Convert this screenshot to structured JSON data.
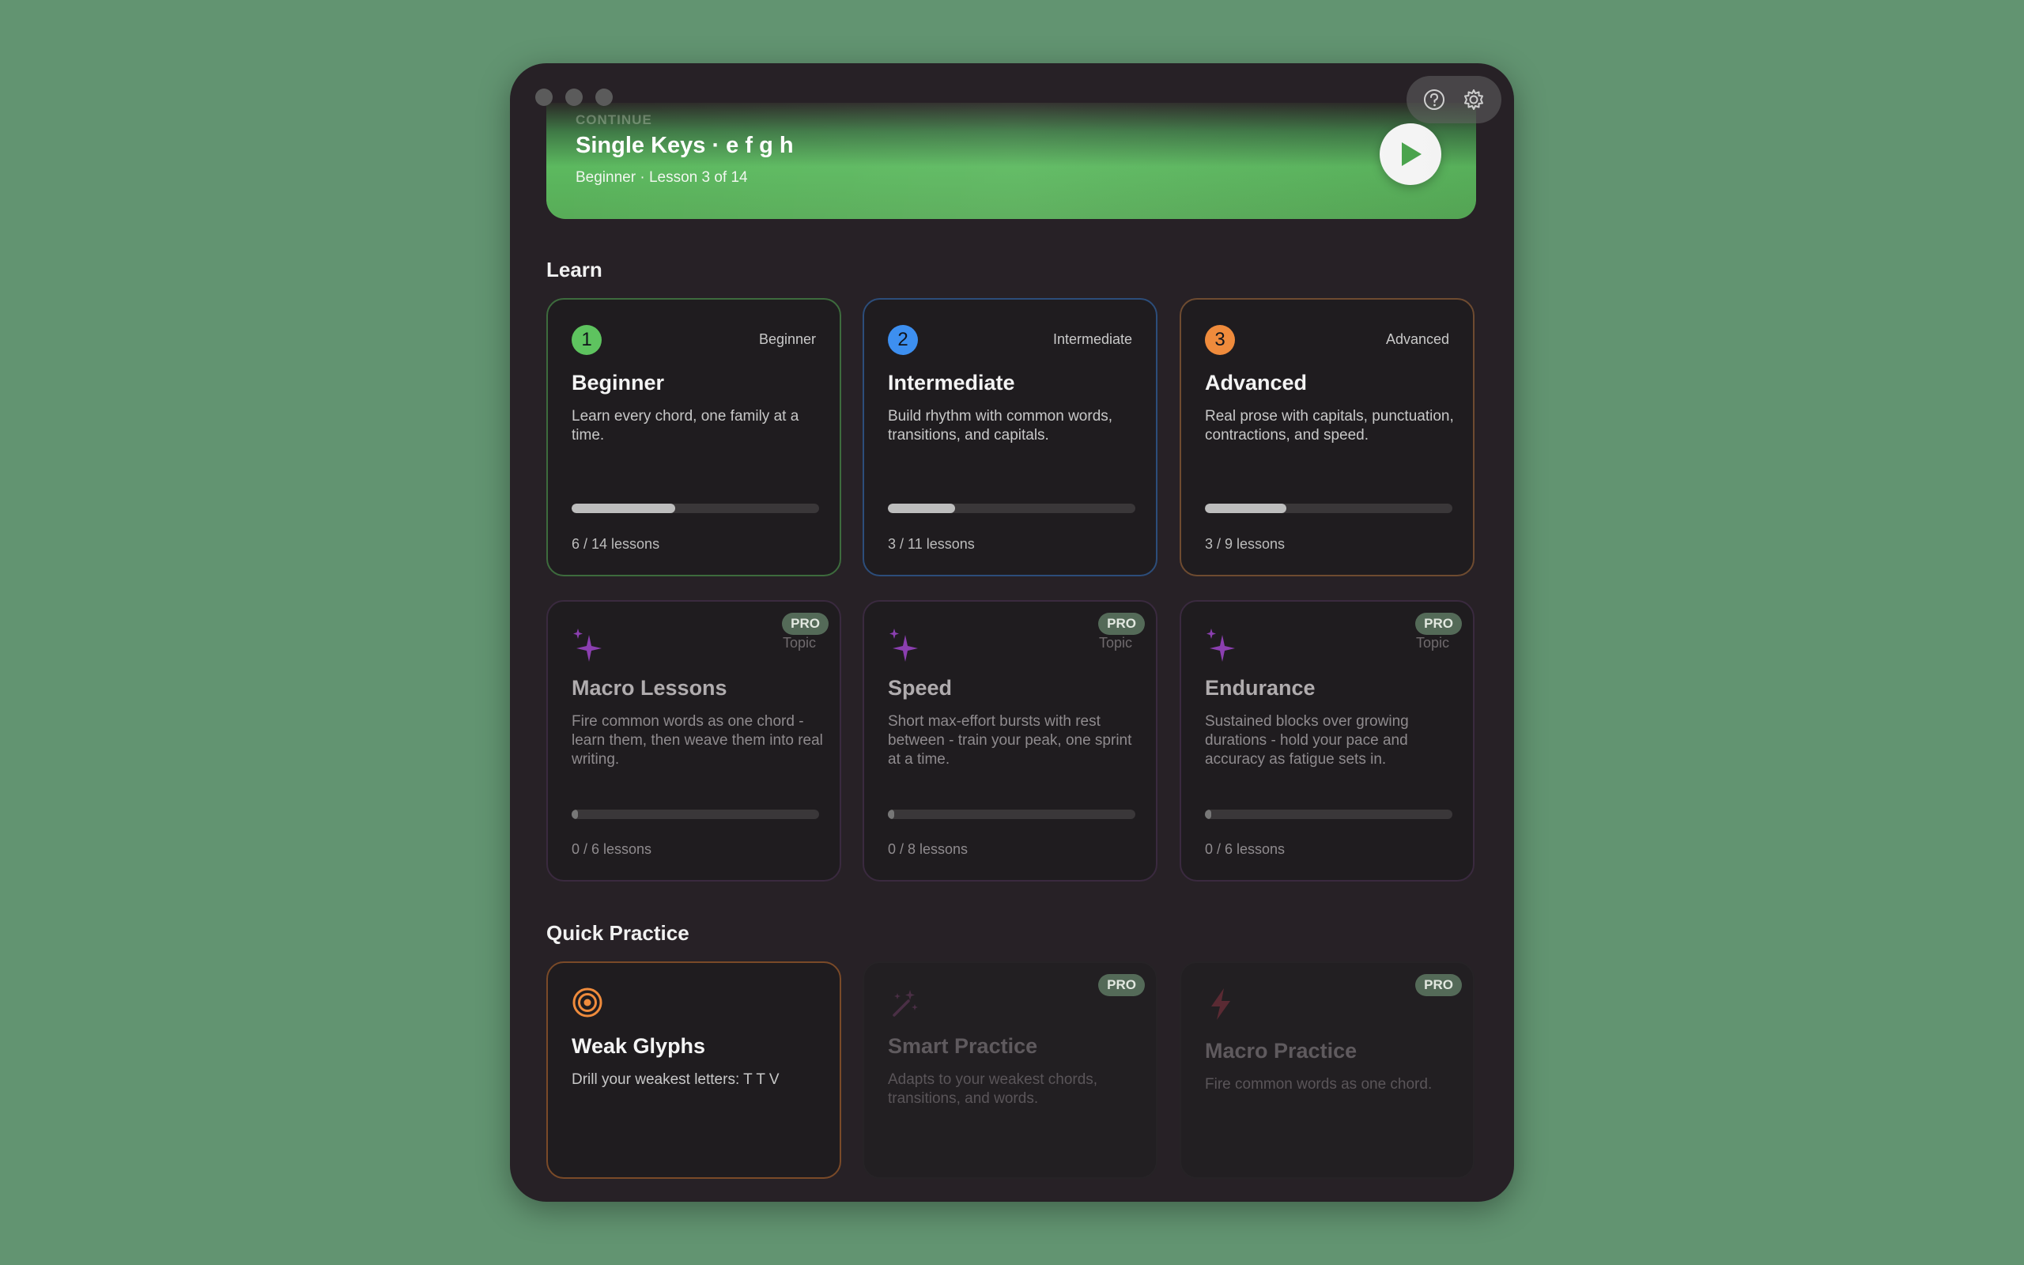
{
  "window": {
    "toolbar": {
      "help_icon": "question-circle-icon",
      "settings_icon": "gear-icon"
    }
  },
  "hero": {
    "kicker": "CONTINUE",
    "title": "Single Keys · e f g h",
    "subtitle": "Beginner · Lesson 3 of 14",
    "play_icon": "play-icon",
    "gradient_color": "#5cb95f"
  },
  "learn": {
    "heading": "Learn",
    "levels": [
      {
        "num": "1",
        "tag": "Beginner",
        "title": "Beginner",
        "desc": "Learn every chord, one family at a time.",
        "progress": 0.42,
        "count": "6 / 14 lessons",
        "color": "#5ec35f"
      },
      {
        "num": "2",
        "tag": "Intermediate",
        "title": "Intermediate",
        "desc": "Build rhythm with common words, transitions, and capitals.",
        "progress": 0.27,
        "count": "3 / 11 lessons",
        "color": "#3d8ff0"
      },
      {
        "num": "3",
        "tag": "Advanced",
        "title": "Advanced",
        "desc": "Real prose with capitals, punctuation, contractions, and speed.",
        "progress": 0.33,
        "count": "3 / 9 lessons",
        "color": "#ef8b3c"
      }
    ],
    "topics": [
      {
        "pro": "PRO",
        "tag": "Topic",
        "title": "Macro Lessons",
        "desc": "Fire common words as one chord - learn them, then weave them into real writing.",
        "progress": 0.0,
        "count": "0 / 6 lessons"
      },
      {
        "pro": "PRO",
        "tag": "Topic",
        "title": "Speed",
        "desc": "Short max-effort bursts with rest between - train your peak, one sprint at a time.",
        "progress": 0.0,
        "count": "0 / 8 lessons"
      },
      {
        "pro": "PRO",
        "tag": "Topic",
        "title": "Endurance",
        "desc": "Sustained blocks over growing durations - hold your pace and accuracy as fatigue sets in.",
        "progress": 0.0,
        "count": "0 / 6 lessons"
      }
    ],
    "topic_color": "#8b3fb0"
  },
  "quick_practice": {
    "heading": "Quick Practice",
    "items": [
      {
        "title": "Weak Glyphs",
        "desc": "Drill your weakest letters: T T V",
        "icon": "target-icon",
        "color": "#ef8b3c"
      },
      {
        "pro": "PRO",
        "title": "Smart Practice",
        "desc": "Adapts to your weakest chords, transitions, and words.",
        "icon": "magic-wand-icon"
      },
      {
        "pro": "PRO",
        "title": "Macro Practice",
        "desc": "Fire common words as one chord.",
        "icon": "lightning-icon"
      }
    ]
  }
}
